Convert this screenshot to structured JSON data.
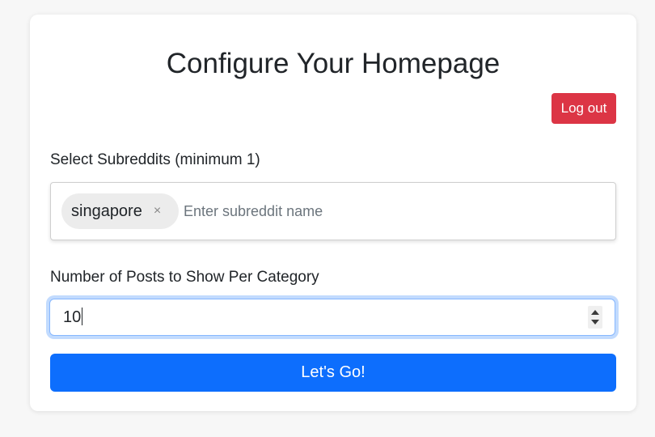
{
  "page": {
    "title": "Configure Your Homepage"
  },
  "header": {
    "logout_label": "Log out"
  },
  "subreddits": {
    "label": "Select Subreddits (minimum 1)",
    "selected": [
      {
        "label": "singapore",
        "remove_glyph": "×"
      }
    ],
    "input_placeholder": "Enter subreddit name",
    "input_value": ""
  },
  "posts": {
    "label": "Number of Posts to Show Per Category",
    "value": "10"
  },
  "submit": {
    "label": "Let's Go!"
  },
  "colors": {
    "logout": "#dc3545",
    "primary": "#0d6efd",
    "focus_ring": "#86b7fe",
    "tag_bg": "#ececec"
  },
  "icons": {
    "tag_remove": "close-icon",
    "spinner_up": "chevron-up-icon",
    "spinner_down": "chevron-down-icon"
  }
}
